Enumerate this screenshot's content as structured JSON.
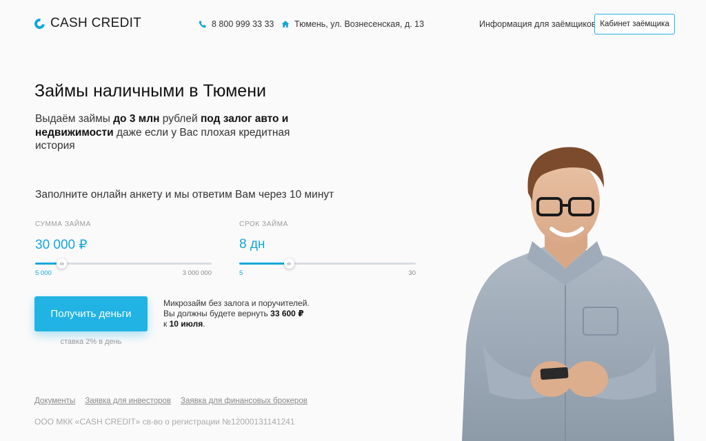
{
  "header": {
    "logo_text": "CASH CREDIT",
    "phone": "8 800 999 33 33",
    "address": "Тюмень, ул. Вознесенская, д. 13",
    "info_link": "Информация для заёмщиков",
    "cabinet_button": "Кабинет заёмщика"
  },
  "hero": {
    "title": "Займы наличными в Тюмени",
    "subtitle": {
      "part1": "Выдаём займы ",
      "bold1": "до 3 млн",
      "part2": " рублей ",
      "bold2": "под залог авто и недвижимости",
      "part3": " даже если у Вас плохая кредитная история"
    }
  },
  "form": {
    "intro": "Заполните онлайн анкету и мы ответим Вам через 10 минут",
    "amount": {
      "label": "Сумма займа",
      "value": "30 000 ₽",
      "min": "5 000",
      "max": "3 000 000",
      "fraction": 0.15
    },
    "term": {
      "label": "Срок займа",
      "value": "8 дн",
      "min": "5",
      "max": "30",
      "fraction": 0.28
    },
    "submit": "Получить деньги",
    "rate": "ставка 2% в день",
    "note": {
      "line1": "Микрозайм без залога и поручителей.",
      "line2_prefix": "Вы должны будете вернуть ",
      "repay_amount": "33 600 ₽",
      "line3_prefix": "к ",
      "repay_date": "10 июля",
      "line3_suffix": "."
    }
  },
  "footer": {
    "links": [
      "Документы",
      "Заявка для инвесторов",
      "Заявка для финансовых брокеров"
    ],
    "legal": "ООО МКК «CASH CREDIT» св-во о регистрации №12000131141241"
  },
  "colors": {
    "accent": "#21b3e3",
    "accent_text": "#12a7d8",
    "background": "#fbfafb"
  }
}
